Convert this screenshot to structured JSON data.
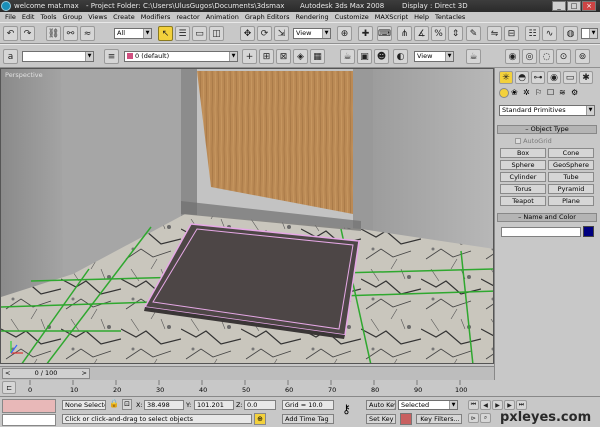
{
  "titlebar": {
    "file": "welcome mat.max",
    "project": "- Project Folder: C:\\Users\\UlusGugos\\Documents\\3dsmax",
    "app": "Autodesk 3ds Max 2008",
    "display": "Display : Direct 3D"
  },
  "menu": [
    "File",
    "Edit",
    "Tools",
    "Group",
    "Views",
    "Create",
    "Modifiers",
    "reactor",
    "Animation",
    "Graph Editors",
    "Rendering",
    "Customize",
    "MAXScript",
    "Help",
    "Tentacles"
  ],
  "toolbar": {
    "selection_filter": "All",
    "ref_coord": "View",
    "layer": "0 (default)",
    "named_selection": "",
    "render_view": "View"
  },
  "viewport": {
    "label": "Perspective"
  },
  "command_panel": {
    "category": "Standard Primitives",
    "object_type_title": "Object Type",
    "autogrid": "AutoGrid",
    "buttons": [
      "Box",
      "Cone",
      "Sphere",
      "GeoSphere",
      "Cylinder",
      "Tube",
      "Torus",
      "Pyramid",
      "Teapot",
      "Plane"
    ],
    "name_color_title": "Name and Color",
    "name_value": "",
    "object_color": "#000080"
  },
  "timeline": {
    "slider_text": "0 / 100",
    "ticks": [
      "0",
      "10",
      "20",
      "30",
      "40",
      "50",
      "60",
      "70",
      "80",
      "90",
      "100"
    ]
  },
  "status": {
    "selection": "None Selecte",
    "x_label": "X:",
    "x_value": "38.498",
    "y_label": "Y:",
    "y_value": "101.201",
    "z_label": "Z:",
    "z_value": "0.0",
    "grid": "Grid = 10.0",
    "prompt": "Click or click-and-drag to select objects",
    "add_time_tag": "Add Time Tag",
    "auto_key": "Auto Key",
    "auto_key_mode": "Selected",
    "set_key": "Set Key",
    "key_filters": "Key Filters..."
  },
  "watermark": "pxleyes.com",
  "colors": {
    "accent": "#f3d13c",
    "viewport_bg": "#7a7a7a",
    "mat": "#4d4646",
    "selection_outline": "#e6a8e6",
    "door": "#b8895a"
  }
}
